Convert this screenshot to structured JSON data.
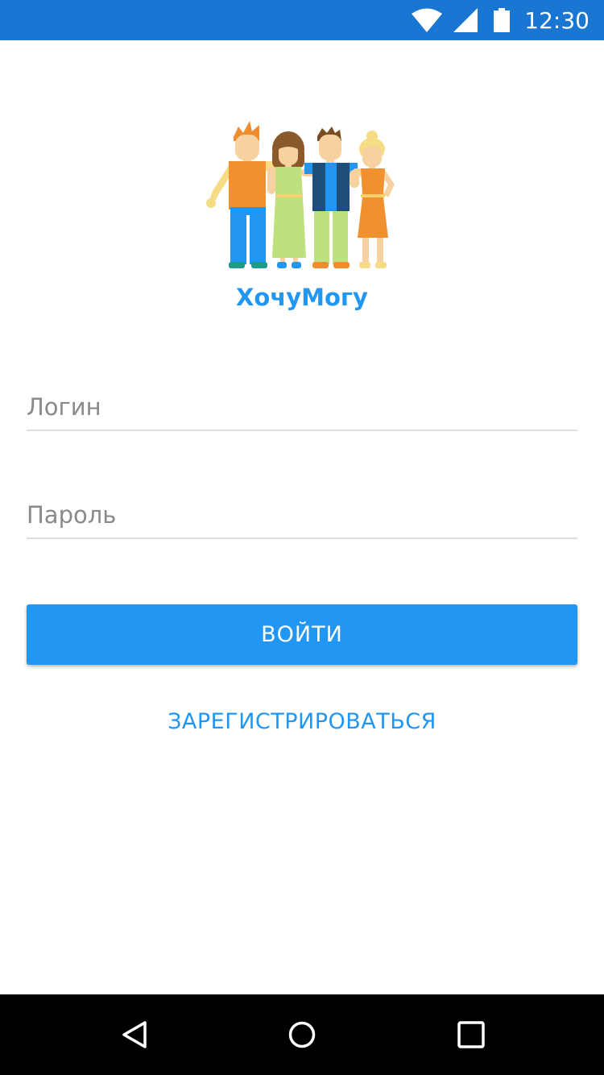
{
  "status_bar": {
    "time": "12:30",
    "icons": [
      "wifi-icon",
      "signal-icon",
      "battery-icon"
    ],
    "color": "#1976D2"
  },
  "app": {
    "name": "ХочуМогу",
    "logo_icon": "people-group-icon",
    "accent_color": "#2196F3"
  },
  "form": {
    "login_placeholder": "Логин",
    "login_value": "",
    "password_placeholder": "Пароль",
    "password_value": "",
    "submit_label": "ВОЙТИ",
    "register_label": "ЗАРЕГИСТРИРОВАТЬСЯ"
  },
  "nav_bar": {
    "icons": [
      "back-icon",
      "home-icon",
      "recents-icon"
    ]
  }
}
